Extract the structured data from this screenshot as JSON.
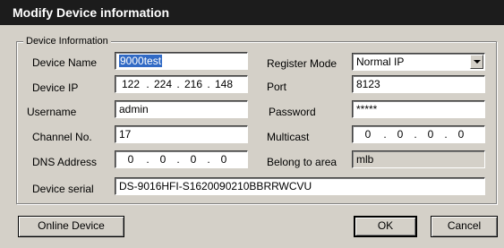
{
  "window": {
    "title": "Modify Device information"
  },
  "group": {
    "title": "Device Information"
  },
  "fields": {
    "device_name": {
      "label": "Device Name",
      "value": "9000test"
    },
    "register_mode": {
      "label": "Register Mode",
      "value": "Normal IP"
    },
    "device_ip": {
      "label": "Device IP",
      "octets": [
        "122",
        "224",
        "216",
        "148"
      ]
    },
    "port": {
      "label": "Port",
      "value": "8123"
    },
    "username": {
      "label": "Username",
      "value": "admin"
    },
    "password": {
      "label": "Password",
      "value": "*****"
    },
    "channel_no": {
      "label": "Channel No.",
      "value": "17"
    },
    "multicast": {
      "label": "Multicast",
      "octets": [
        "0",
        "0",
        "0",
        "0"
      ]
    },
    "dns_address": {
      "label": "DNS Address",
      "octets": [
        "0",
        "0",
        "0",
        "0"
      ]
    },
    "belong_to_area": {
      "label": "Belong to area",
      "value": "mlb"
    },
    "device_serial": {
      "label": "Device serial",
      "value": "DS-9016HFI-S1620090210BBRRWCVU"
    }
  },
  "buttons": {
    "online_device": "Online Device",
    "ok": "OK",
    "cancel": "Cancel"
  }
}
